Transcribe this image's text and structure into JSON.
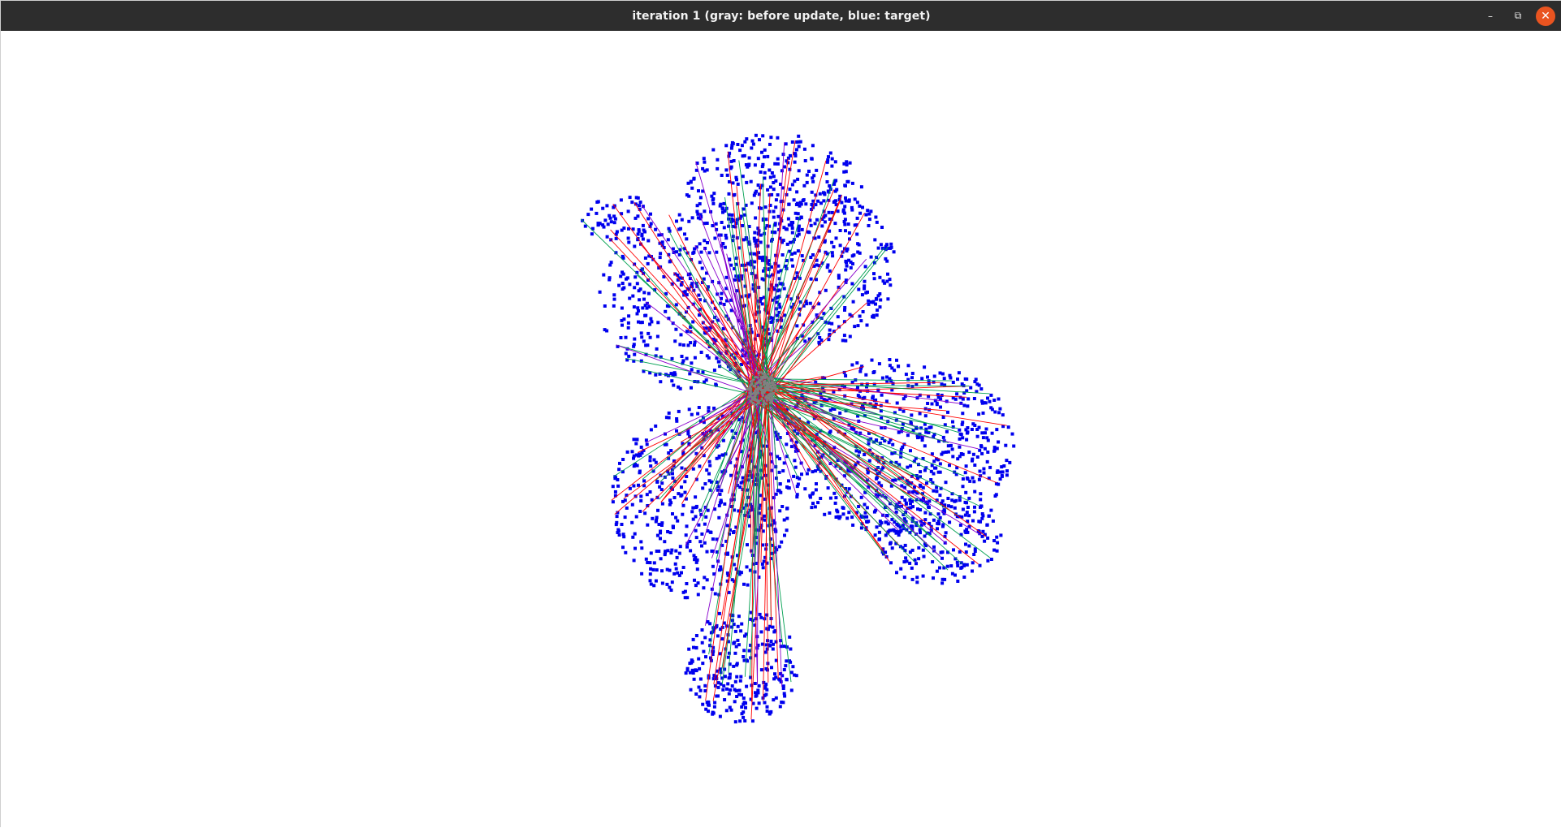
{
  "window": {
    "title": "iteration 1 (gray: before update, blue: target)"
  },
  "controls": {
    "minimize_glyph": "–",
    "maximize_glyph": "⧉",
    "close_glyph": "✕"
  },
  "colors": {
    "titlebar": "#2d2d2d",
    "close": "#e95420",
    "target_points": "#0000ee",
    "source_points": "#808080",
    "correspondence_a": "#ff0000",
    "correspondence_b": "#00a050",
    "correspondence_c": "#8800cc",
    "background": "#ffffff"
  },
  "legend": {
    "gray": "before update",
    "blue": "target"
  }
}
